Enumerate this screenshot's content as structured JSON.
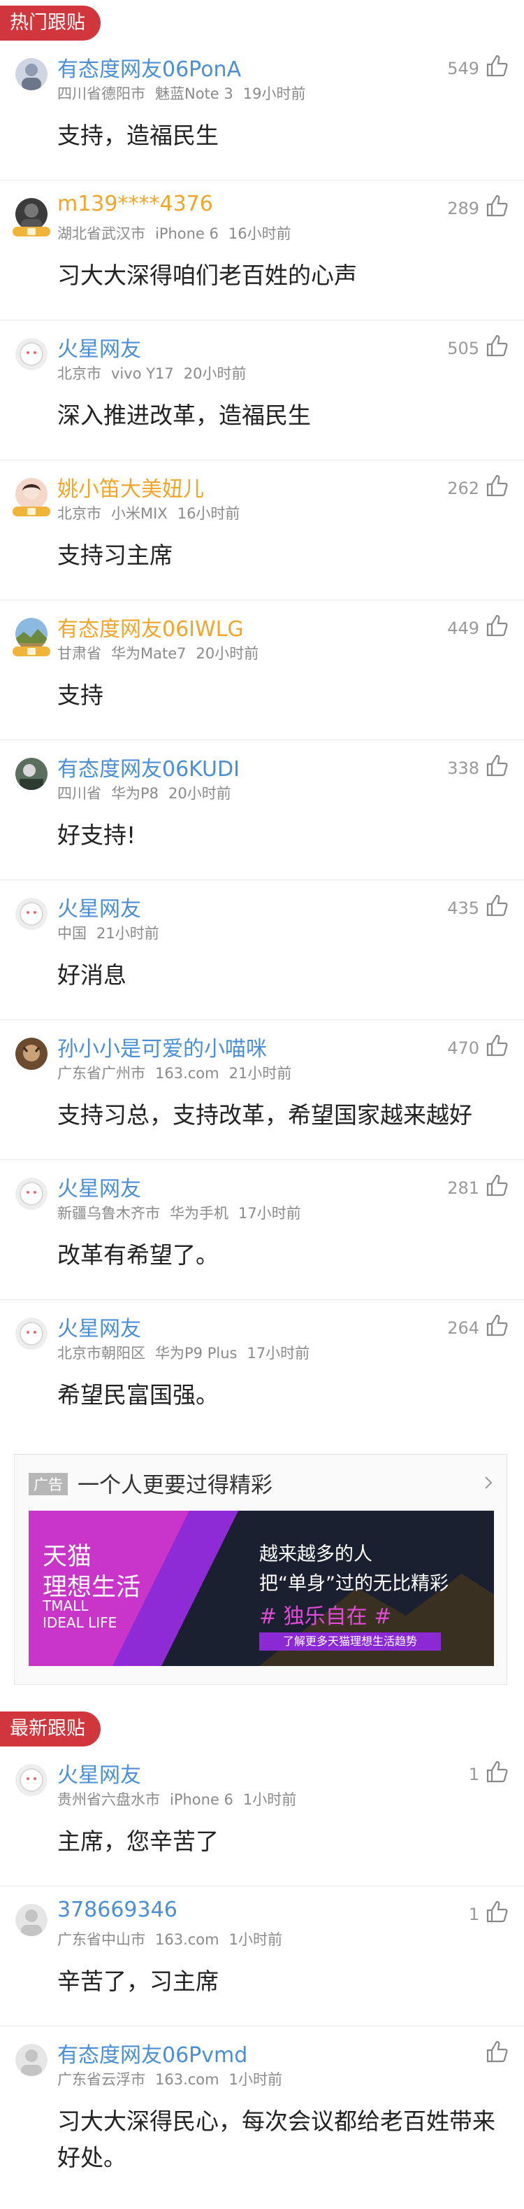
{
  "hot": {
    "section_label": "热门跟贴",
    "comments": [
      {
        "user": "有态度网友06PonA",
        "location": "四川省德阳市",
        "device": "魅蓝Note 3",
        "time": "19小时前",
        "likes": "549",
        "content": "支持，造福民生"
      },
      {
        "user": "m139****4376",
        "location": "湖北省武汉市",
        "device": "iPhone 6",
        "time": "16小时前",
        "likes": "289",
        "content": "习大大深得咱们老百姓的心声"
      },
      {
        "user": "火星网友",
        "location": "北京市",
        "device": "vivo Y17",
        "time": "20小时前",
        "likes": "505",
        "content": "深入推进改革，造福民生"
      },
      {
        "user": "姚小笛大美妞儿",
        "location": "北京市",
        "device": "小米MIX",
        "time": "16小时前",
        "likes": "262",
        "content": "支持习主席"
      },
      {
        "user": "有态度网友06IWLG",
        "location": "甘肃省",
        "device": "华为Mate7",
        "time": "20小时前",
        "likes": "449",
        "content": "支持"
      },
      {
        "user": "有态度网友06KUDI",
        "location": "四川省",
        "device": "华为P8",
        "time": "20小时前",
        "likes": "338",
        "content": "好支持!"
      },
      {
        "user": "火星网友",
        "location": "中国",
        "device": "",
        "time": "21小时前",
        "likes": "435",
        "content": "好消息"
      },
      {
        "user": "孙小小是可爱的小喵咪",
        "location": "广东省广州市",
        "device": "163.com",
        "time": "21小时前",
        "likes": "470",
        "content": "支持习总，支持改革，希望国家越来越好"
      },
      {
        "user": "火星网友",
        "location": "新疆乌鲁木齐市",
        "device": "华为手机",
        "time": "17小时前",
        "likes": "281",
        "content": "改革有希望了。"
      },
      {
        "user": "火星网友",
        "location": "北京市朝阳区",
        "device": "华为P9 Plus",
        "time": "17小时前",
        "likes": "264",
        "content": "希望民富国强。"
      }
    ]
  },
  "ad": {
    "tag": "广告",
    "title": "一个人更要过得精彩",
    "banner_brand_line1": "天猫",
    "banner_brand_line2": "理想生活",
    "banner_en_line1": "TMALL",
    "banner_en_line2": "IDEAL LIFE",
    "banner_headline1": "越来越多的人",
    "banner_headline2": "把“单身”过的无比精彩",
    "banner_hashtag": "# 独乐自在 #",
    "banner_button": "了解更多天猫理想生活趋势"
  },
  "latest": {
    "section_label": "最新跟贴",
    "comments": [
      {
        "user": "火星网友",
        "location": "贵州省六盘水市",
        "device": "iPhone 6",
        "time": "1小时前",
        "likes": "1",
        "content": "主席，您辛苦了"
      },
      {
        "user": "378669346",
        "location": "广东省中山市",
        "device": "163.com",
        "time": "1小时前",
        "likes": "1",
        "content": "辛苦了，习主席"
      },
      {
        "user": "有态度网友06Pvmd",
        "location": "广东省云浮市",
        "device": "163.com",
        "time": "1小时前",
        "likes": "",
        "content": "习大大深得民心，每次会议都给老百姓带来好处。"
      }
    ]
  }
}
